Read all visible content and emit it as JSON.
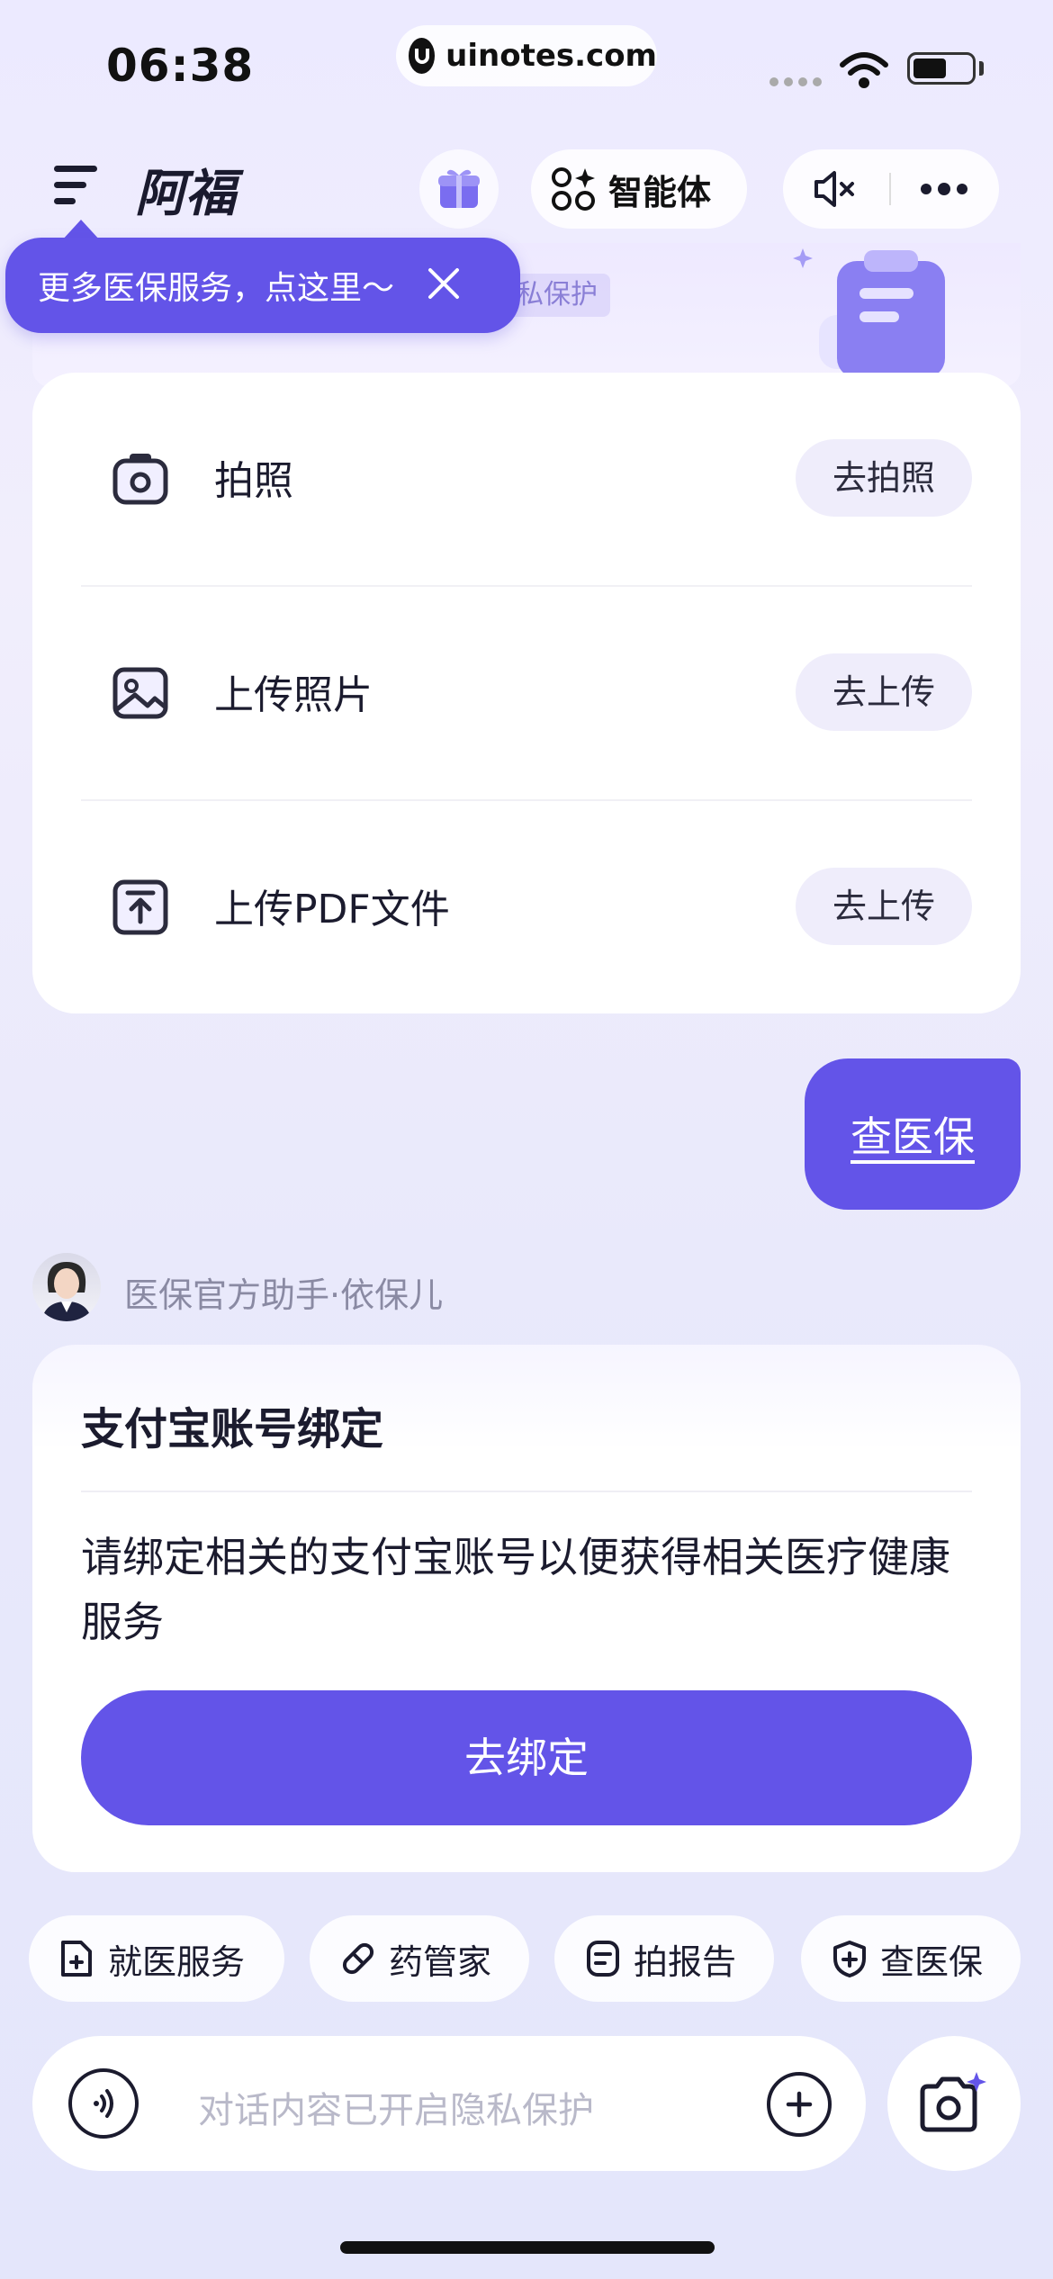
{
  "status_bar": {
    "time": "06:38",
    "url": "uinotes.com"
  },
  "header": {
    "title": "阿福",
    "agent_label": "智能体"
  },
  "tooltip": {
    "text": "更多医保服务，点这里～"
  },
  "top_card": {
    "privacy_tag": "私保护"
  },
  "upload_options": [
    {
      "label": "拍照",
      "action": "去拍照",
      "icon": "camera-icon"
    },
    {
      "label": "上传照片",
      "action": "去上传",
      "icon": "image-icon"
    },
    {
      "label": "上传PDF文件",
      "action": "去上传",
      "icon": "upload-file-icon"
    }
  ],
  "user_message": "查医保",
  "assistant": {
    "name": "医保官方助手·依保儿"
  },
  "bind_card": {
    "title": "支付宝账号绑定",
    "description": "请绑定相关的支付宝账号以便获得相关医疗健康服务",
    "button": "去绑定"
  },
  "quick_actions": [
    {
      "label": "就医服务",
      "icon": "medical-doc-icon"
    },
    {
      "label": "药管家",
      "icon": "pill-icon"
    },
    {
      "label": "拍报告",
      "icon": "report-icon"
    },
    {
      "label": "查医保",
      "icon": "shield-plus-icon"
    }
  ],
  "input": {
    "placeholder": "对话内容已开启隐私保护"
  },
  "colors": {
    "accent": "#6354e8",
    "button_bg": "#efedfb"
  }
}
